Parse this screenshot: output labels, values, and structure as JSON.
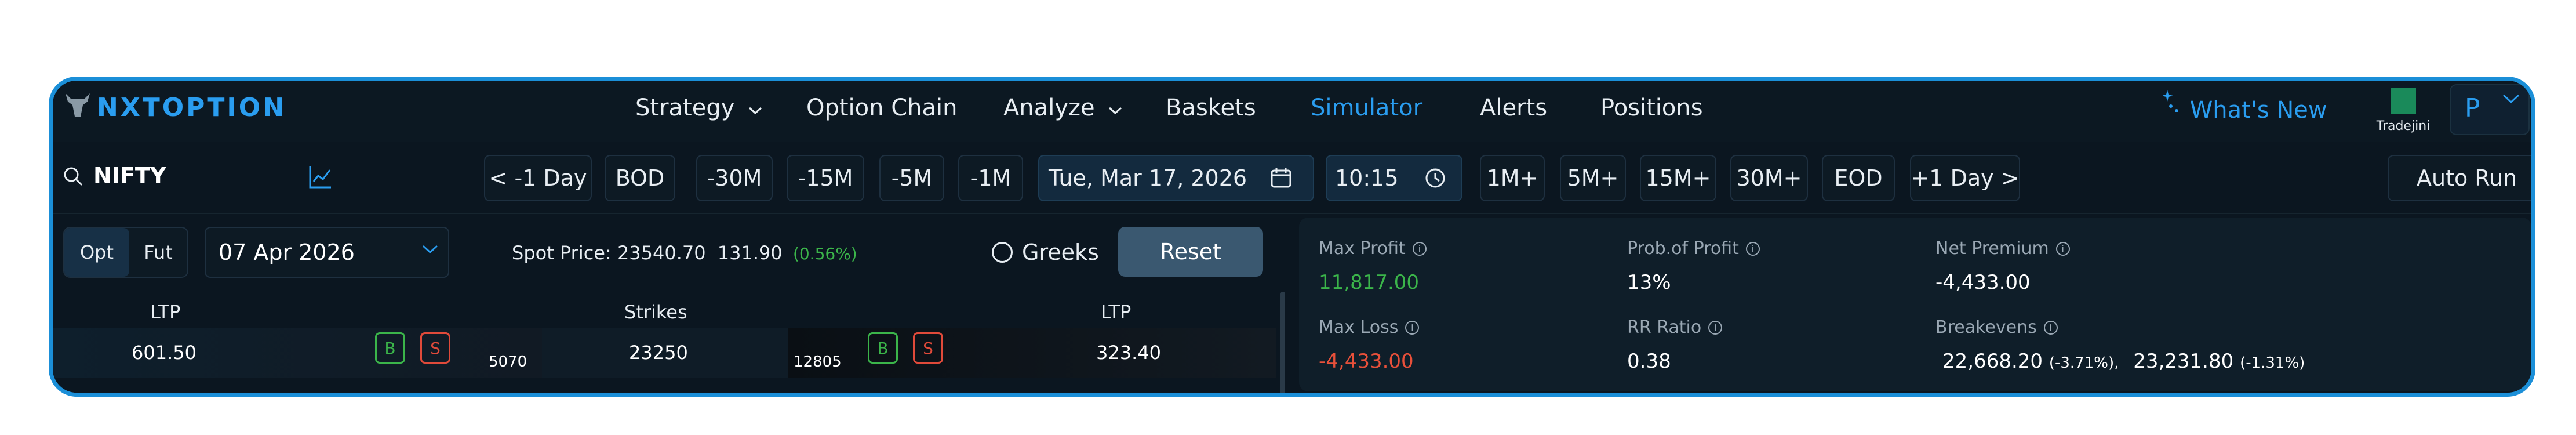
{
  "brand": {
    "name": "NXTOPTION"
  },
  "nav": {
    "items": [
      {
        "label": "Strategy",
        "dropdown": true
      },
      {
        "label": "Option Chain",
        "dropdown": false
      },
      {
        "label": "Analyze",
        "dropdown": true
      },
      {
        "label": "Baskets",
        "dropdown": false
      },
      {
        "label": "Simulator",
        "dropdown": false,
        "active": true
      },
      {
        "label": "Alerts",
        "dropdown": false
      },
      {
        "label": "Positions",
        "dropdown": false
      }
    ],
    "whats_new": "What's New",
    "broker": "Tradejini",
    "profile_initial": "P"
  },
  "toolbar": {
    "search_value": "NIFTY",
    "buttons": [
      "< -1 Day",
      "BOD",
      "-30M",
      "-15M",
      "-5M",
      "-1M"
    ],
    "date": "Tue, Mar 17, 2026",
    "time": "10:15",
    "forward_buttons": [
      "1M+",
      "5M+",
      "15M+",
      "30M+",
      "EOD",
      "+1 Day >"
    ],
    "auto_run": "Auto Run"
  },
  "chain": {
    "opt_label": "Opt",
    "fut_label": "Fut",
    "expiry": "07 Apr 2026",
    "spot_label": "Spot Price:",
    "spot_price": "23540.70",
    "spot_change": "131.90",
    "spot_change_pct": "(0.56%)",
    "greeks_label": "Greeks",
    "reset_label": "Reset",
    "headers": {
      "ltp_call": "LTP",
      "strikes": "Strikes",
      "ltp_put": "LTP"
    },
    "row": {
      "call_ltp": "601.50",
      "buy": "B",
      "sell": "S",
      "call_oi": "5070",
      "strike": "23250",
      "put_oi": "12805",
      "put_ltp": "323.40"
    }
  },
  "stats": {
    "max_profit_label": "Max Profit",
    "max_profit": "11,817.00",
    "pop_label": "Prob.of Profit",
    "pop": "13%",
    "net_premium_label": "Net Premium",
    "net_premium": "-4,433.00",
    "max_loss_label": "Max Loss",
    "max_loss": "-4,433.00",
    "rr_label": "RR Ratio",
    "rr": "0.38",
    "breakevens_label": "Breakevens",
    "be1": "22,668.20",
    "be1_pct": "(-3.71%),",
    "be2": "23,231.80",
    "be2_pct": "(-1.31%)"
  },
  "colors": {
    "accent": "#2a9df0",
    "profit": "#3bb54a",
    "loss": "#e8503a",
    "frame": "#1b8fd8"
  }
}
